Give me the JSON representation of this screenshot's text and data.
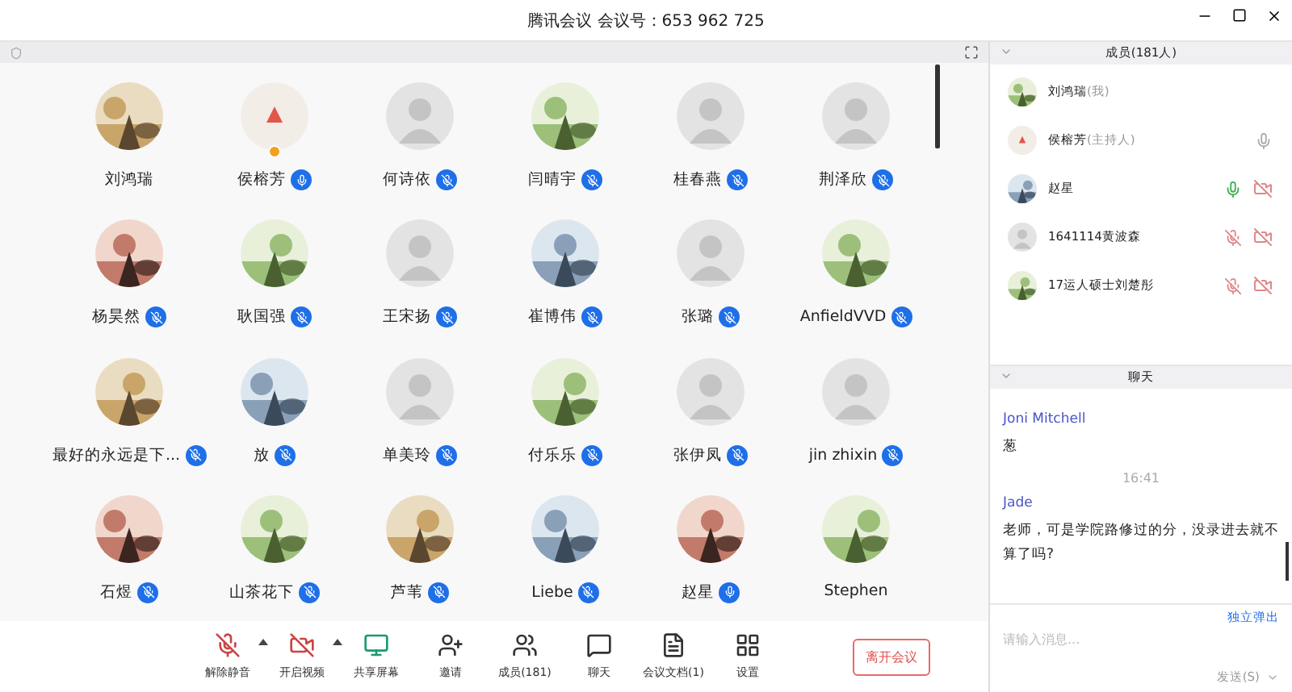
{
  "window": {
    "title": "腾讯会议 会议号：653 962 725"
  },
  "participants": [
    {
      "name": "刘鸿瑞",
      "kind": "picture",
      "mic": false
    },
    {
      "name": "侯榕芳",
      "kind": "host",
      "mic": true,
      "muted": false
    },
    {
      "name": "何诗依",
      "kind": "default",
      "mic": true,
      "muted": true
    },
    {
      "name": "闫晴宇",
      "kind": "picture",
      "mic": true,
      "muted": true
    },
    {
      "name": "桂春燕",
      "kind": "default",
      "mic": true,
      "muted": true
    },
    {
      "name": "荆泽欣",
      "kind": "default",
      "mic": true,
      "muted": true
    },
    {
      "name": "杨昊然",
      "kind": "picture",
      "mic": true,
      "muted": true
    },
    {
      "name": "耿国强",
      "kind": "picture",
      "mic": true,
      "muted": true
    },
    {
      "name": "王宋扬",
      "kind": "default",
      "mic": true,
      "muted": true
    },
    {
      "name": "崔博伟",
      "kind": "picture",
      "mic": true,
      "muted": true
    },
    {
      "name": "张璐",
      "kind": "default",
      "mic": true,
      "muted": true
    },
    {
      "name": "AnfieldVVD",
      "kind": "picture",
      "mic": true,
      "muted": true
    },
    {
      "name": "最好的永远是下...",
      "kind": "picture",
      "mic": true,
      "muted": true
    },
    {
      "name": "放",
      "kind": "picture",
      "mic": true,
      "muted": true
    },
    {
      "name": "单美玲",
      "kind": "default",
      "mic": true,
      "muted": true
    },
    {
      "name": "付乐乐",
      "kind": "picture",
      "mic": true,
      "muted": true
    },
    {
      "name": "张伊凤",
      "kind": "default",
      "mic": true,
      "muted": true
    },
    {
      "name": "jin zhixin",
      "kind": "default",
      "mic": true,
      "muted": true
    },
    {
      "name": "石煜",
      "kind": "picture",
      "mic": true,
      "muted": true
    },
    {
      "name": "山茶花下",
      "kind": "picture",
      "mic": true,
      "muted": true
    },
    {
      "name": "芦苇",
      "kind": "picture",
      "mic": true,
      "muted": true
    },
    {
      "name": "Liebe",
      "kind": "picture",
      "mic": true,
      "muted": true
    },
    {
      "name": "赵星",
      "kind": "picture",
      "mic": true,
      "muted": false
    },
    {
      "name": "Stephen",
      "kind": "picture",
      "mic": false
    }
  ],
  "toolbar": [
    {
      "label": "解除静音",
      "kind": "mic",
      "caret": true
    },
    {
      "label": "开启视频",
      "kind": "video",
      "caret": true
    },
    {
      "label": "共享屏幕",
      "kind": "share",
      "caret": false
    },
    {
      "label": "邀请",
      "kind": "invite",
      "caret": false
    },
    {
      "label": "成员(181)",
      "kind": "members",
      "caret": false
    },
    {
      "label": "聊天",
      "kind": "chat",
      "caret": false
    },
    {
      "label": "会议文档(1)",
      "kind": "doc",
      "caret": false
    },
    {
      "label": "设置",
      "kind": "settings",
      "caret": false
    }
  ],
  "leave_button": "离开会议",
  "members_panel": {
    "title": "成员(181人)",
    "members": [
      {
        "name": "刘鸿瑞",
        "role": "(我)",
        "kind": "picture",
        "mic": false,
        "camera_off": false
      },
      {
        "name": "侯榕芳",
        "role": "(主持人)",
        "kind": "host",
        "mic": true,
        "muted": false,
        "speaking": false,
        "camera_off": false
      },
      {
        "name": "赵星",
        "kind": "picture",
        "mic": true,
        "muted": false,
        "speaking": true,
        "camera_off": true
      },
      {
        "name": "1641114黄波森",
        "kind": "default",
        "mic": true,
        "muted": true,
        "camera_off": true
      },
      {
        "name": "17运人硕士刘楚彤",
        "kind": "picture",
        "mic": true,
        "muted": true,
        "camera_off": true
      }
    ]
  },
  "chat_panel": {
    "title": "聊天",
    "messages": [
      {
        "kind": "sender",
        "text": "Joni Mitchell"
      },
      {
        "kind": "text",
        "text": "葱"
      },
      {
        "kind": "time",
        "text": "16:41"
      },
      {
        "kind": "sender",
        "text": "Jade"
      },
      {
        "kind": "text",
        "text": "老师，可是学院路修过的分，没录进去就不算了吗?"
      }
    ],
    "popout_link": "独立弹出",
    "input": {
      "placeholder": "请输入消息..."
    },
    "send_button": "发送(S)"
  }
}
